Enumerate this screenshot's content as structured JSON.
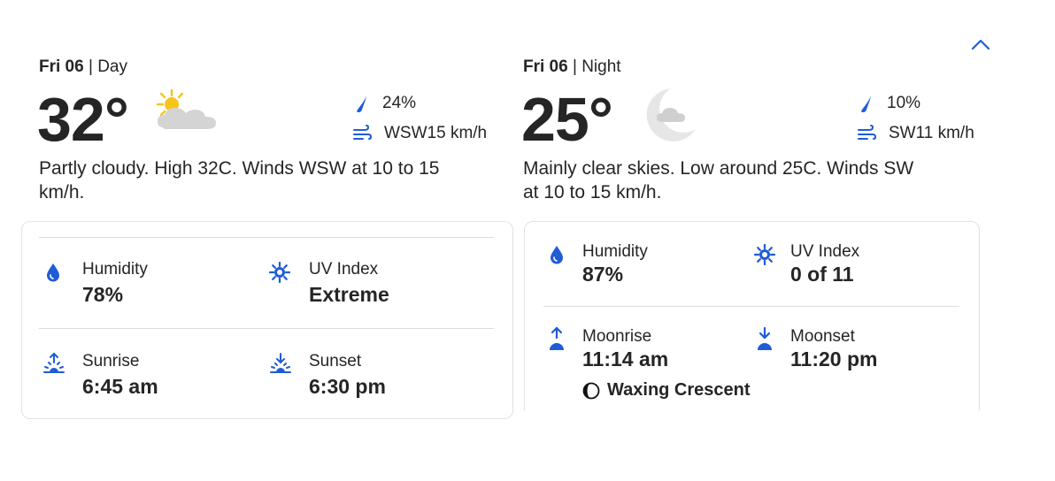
{
  "collapse": {
    "icon": "chevron-up-icon"
  },
  "day": {
    "date": "Fri 06",
    "period": "Day",
    "temperature": "32°",
    "condition_icon": "partly-cloudy-day-icon",
    "precipitation": "24%",
    "wind": "WSW15 km/h",
    "description": "Partly cloudy. High 32C. Winds WSW at 10 to 15 km/h.",
    "details": {
      "humidity_label": "Humidity",
      "humidity_value": "78%",
      "uv_label": "UV Index",
      "uv_value": "Extreme",
      "sunrise_label": "Sunrise",
      "sunrise_value": "6:45 am",
      "sunset_label": "Sunset",
      "sunset_value": "6:30 pm"
    }
  },
  "night": {
    "date": "Fri 06",
    "period": "Night",
    "temperature": "25°",
    "condition_icon": "mostly-clear-night-icon",
    "precipitation": "10%",
    "wind": "SW11 km/h",
    "description": "Mainly clear skies. Low around 25C. Winds SW at 10 to 15 km/h.",
    "details": {
      "humidity_label": "Humidity",
      "humidity_value": "87%",
      "uv_label": "UV Index",
      "uv_value": "0 of 11",
      "moonrise_label": "Moonrise",
      "moonrise_value": "11:14 am",
      "moonset_label": "Moonset",
      "moonset_value": "11:20 pm",
      "moon_phase": "Waxing Crescent"
    }
  },
  "colors": {
    "accent": "#1f5cd6",
    "text": "#252525",
    "divider": "#dcdcdc"
  }
}
